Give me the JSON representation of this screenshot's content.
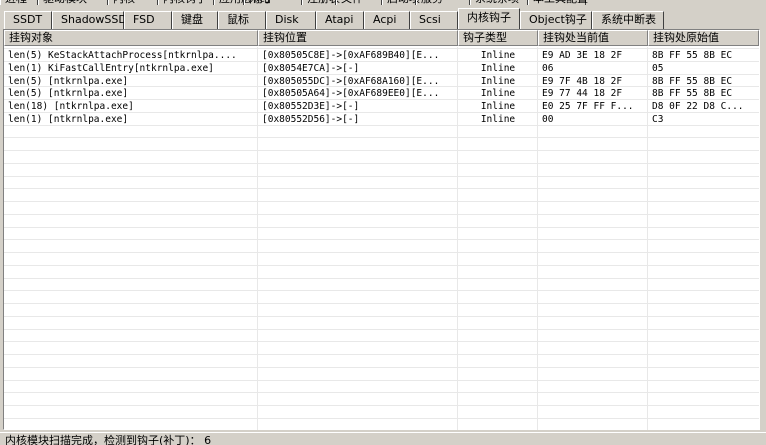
{
  "top_tabs": [
    "进程",
    "驱动模块",
    "内核",
    "内核钩子",
    "应用层钩子",
    "网络",
    "注册表",
    "文件",
    "启动项",
    "服务",
    "系统杂项",
    "本工具配置"
  ],
  "sub_tabs": [
    {
      "label": "SSDT",
      "active": false
    },
    {
      "label": "ShadowSSDT",
      "active": false
    },
    {
      "label": "FSD",
      "active": false
    },
    {
      "label": "键盘",
      "active": false
    },
    {
      "label": "鼠标",
      "active": false
    },
    {
      "label": "Disk",
      "active": false
    },
    {
      "label": "Atapi",
      "active": false
    },
    {
      "label": "Acpi",
      "active": false
    },
    {
      "label": "Scsi",
      "active": false
    },
    {
      "label": "内核钩子",
      "active": true
    },
    {
      "label": "Object钩子",
      "active": false
    },
    {
      "label": "系统中断表",
      "active": false
    }
  ],
  "table": {
    "columns": [
      "挂钩对象",
      "挂钩位置",
      "钩子类型",
      "挂钩处当前值",
      "挂钩处原始值"
    ],
    "rows": [
      [
        "len(5) KeStackAttachProcess[ntkrnlpa....",
        "[0x80505C8E]->[0xAF689B40][E...",
        "Inline",
        "E9 AD 3E 18 2F",
        "8B FF 55 8B EC"
      ],
      [
        "len(1) KiFastCallEntry[ntkrnlpa.exe]",
        "[0x8054E7CA]->[-]",
        "Inline",
        "06",
        "05"
      ],
      [
        "len(5) [ntkrnlpa.exe]",
        "[0x805055DC]->[0xAF68A160][E...",
        "Inline",
        "E9 7F 4B 18 2F",
        "8B FF 55 8B EC"
      ],
      [
        "len(5) [ntkrnlpa.exe]",
        "[0x80505A64]->[0xAF689EE0][E...",
        "Inline",
        "E9 77 44 18 2F",
        "8B FF 55 8B EC"
      ],
      [
        "len(18) [ntkrnlpa.exe]",
        "[0x80552D3E]->[-]",
        "Inline",
        "E0 25 7F FF F...",
        "D8 0F 22 D8 C..."
      ],
      [
        "len(1) [ntkrnlpa.exe]",
        "[0x80552D56]->[-]",
        "Inline",
        "00",
        "C3"
      ]
    ]
  },
  "status": {
    "text": "内核模块扫描完成，检测到钩子(补丁)：  6"
  }
}
